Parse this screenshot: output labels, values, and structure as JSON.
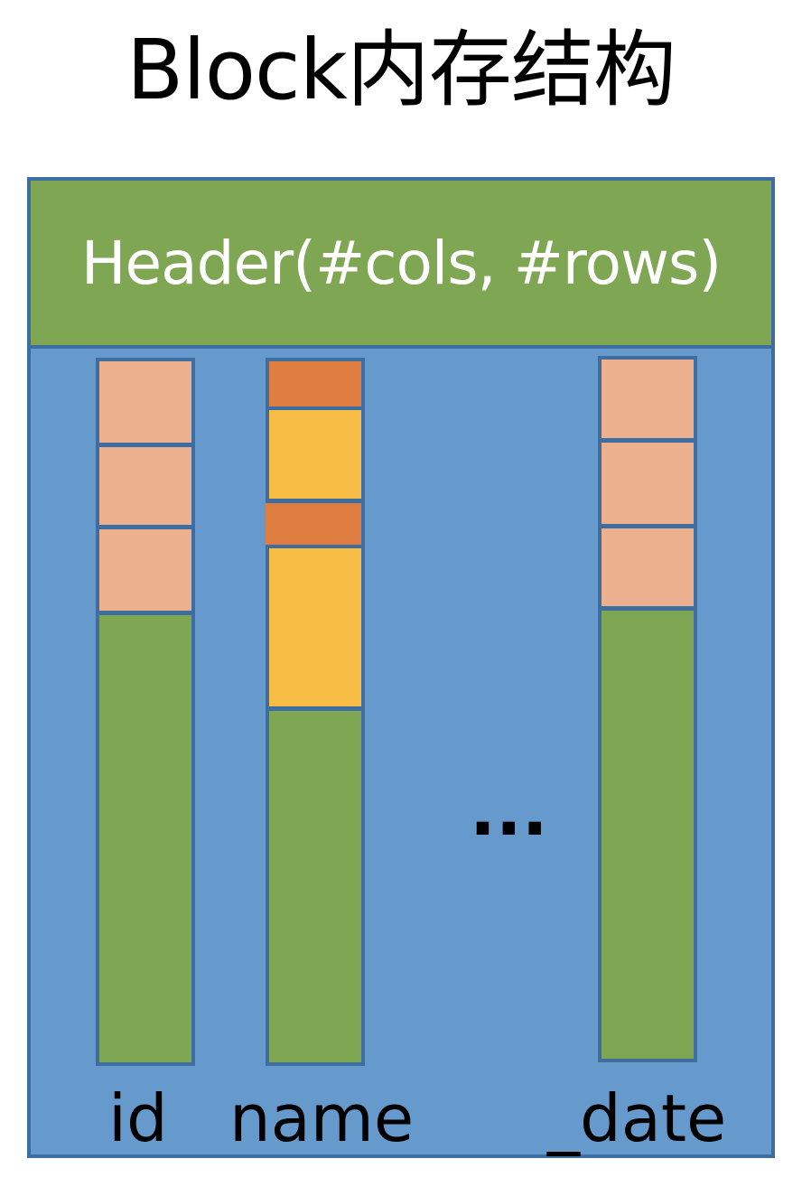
{
  "title": "Block内存结构",
  "header": {
    "label": "Header(#cols, #rows)"
  },
  "columns": [
    {
      "label": "id"
    },
    {
      "label": "name"
    },
    {
      "label": "_date"
    }
  ],
  "ellipsis": "...",
  "colors": {
    "block_fill": "#6699cc",
    "block_border": "#3e6ea0",
    "header_fill": "#7fa653",
    "column_fill": "#7fa653",
    "value_cell": "#ecb08f",
    "size_cell": "#e07e42",
    "string_cell": "#f8bd44",
    "header_text": "#ffffff"
  }
}
